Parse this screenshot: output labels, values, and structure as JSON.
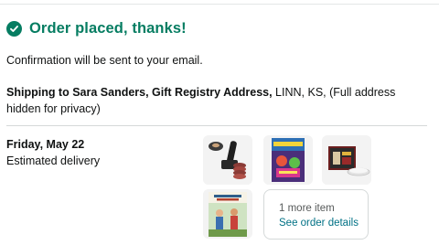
{
  "header": {
    "title": "Order placed, thanks!"
  },
  "confirmation": {
    "text": "Confirmation will be sent to your email."
  },
  "shipping": {
    "label": "Shipping to Sara Sanders, Gift Registry Address,",
    "address": " LINN, KS, (Full address hidden for privacy)"
  },
  "delivery": {
    "date": "Friday, May 22",
    "label": "Estimated delivery"
  },
  "items": {
    "thumbnails": [
      "burger-press-tool-icon",
      "colorful-book-cover-icon",
      "board-game-box-icon",
      "childrens-book-cover-icon"
    ],
    "more_count": "1 more item",
    "details_link": "See order details"
  },
  "colors": {
    "success": "#067d62",
    "link": "#007185",
    "muted": "#565959"
  }
}
